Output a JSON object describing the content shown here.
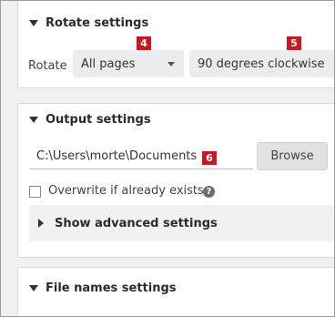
{
  "rotate_settings": {
    "title": "Rotate settings",
    "rotate_label": "Rotate",
    "pages_select": "All pages",
    "direction_select": "90 degrees clockwise",
    "badge_pages": "4",
    "badge_direction": "5"
  },
  "output_settings": {
    "title": "Output settings",
    "path_value": "C:\\Users\\morte\\Documents",
    "badge_path": "6",
    "browse_label": "Browse",
    "overwrite_label": "Overwrite if already exists",
    "help_glyph": "?",
    "advanced_label": "Show advanced settings"
  },
  "file_names_settings": {
    "title": "File names settings"
  },
  "colors": {
    "badge": "#c9181e",
    "card_bg": "#ffffff",
    "page_bg": "#f0f0f0"
  }
}
